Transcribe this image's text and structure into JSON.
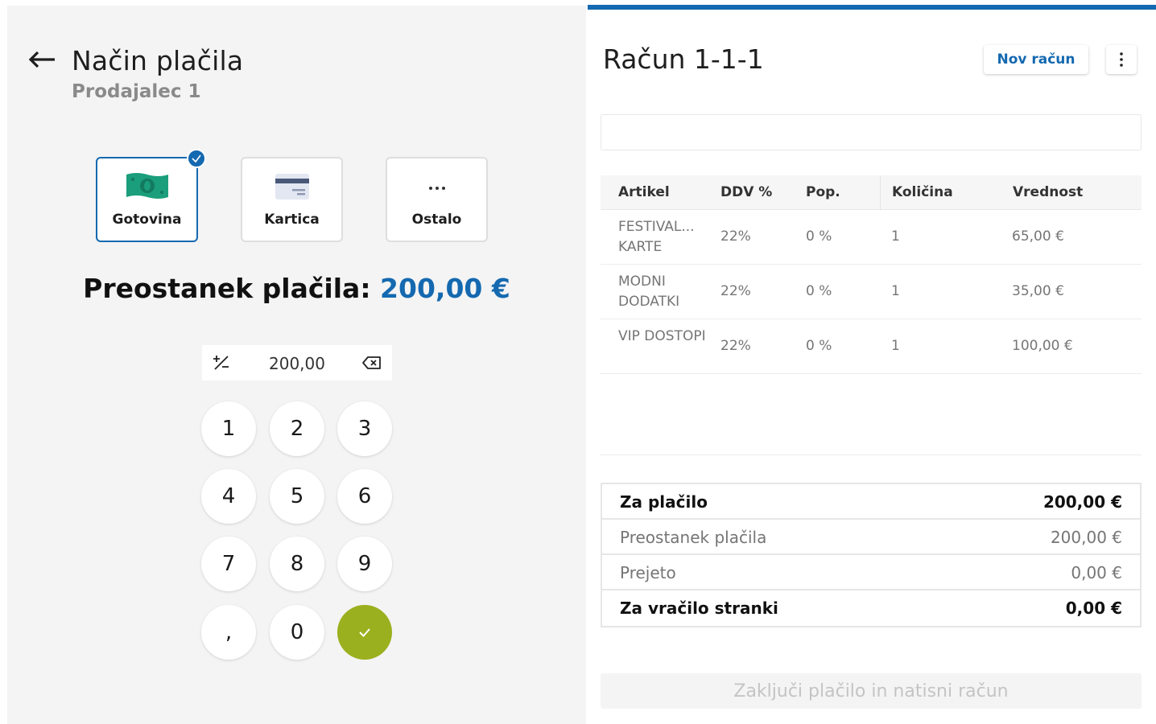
{
  "payment": {
    "title": "Način plačila",
    "subtitle": "Prodajalec 1",
    "methods": [
      {
        "label": "Gotovina",
        "icon": "cash-icon",
        "selected": true
      },
      {
        "label": "Kartica",
        "icon": "card-icon",
        "selected": false
      },
      {
        "label": "Ostalo",
        "icon": "more-horizontal-icon",
        "selected": false
      }
    ],
    "remaining_label": "Preostanek plačila:",
    "remaining_amount": "200,00 €",
    "amount_value": "200,00",
    "keypad": [
      "1",
      "2",
      "3",
      "4",
      "5",
      "6",
      "7",
      "8",
      "9",
      ",",
      "0"
    ]
  },
  "receipt": {
    "title": "Račun 1-1-1",
    "new_button": "Nov račun",
    "columns": [
      "Artikel",
      "DDV %",
      "Pop.",
      "Količina",
      "Vrednost"
    ],
    "items": [
      {
        "name": "FESTIVAL... KARTE",
        "vat": "22%",
        "discount": "0 %",
        "qty": "1",
        "value": "65,00 €"
      },
      {
        "name": "MODNI DODATKI",
        "vat": "22%",
        "discount": "0 %",
        "qty": "1",
        "value": "35,00 €"
      },
      {
        "name": "VIP DOSTOPI",
        "vat": "22%",
        "discount": "0 %",
        "qty": "1",
        "value": "100,00 €"
      }
    ],
    "summary": {
      "to_pay_label": "Za plačilo",
      "to_pay": "200,00 €",
      "remaining_label": "Preostanek plačila",
      "remaining": "200,00 €",
      "received_label": "Prejeto",
      "received": "0,00 €",
      "change_label": "Za vračilo stranki",
      "change": "0,00 €"
    },
    "finish_button": "Zaključi plačilo in natisni račun"
  },
  "colors": {
    "accent": "#1469b0",
    "confirm": "#9bb01e",
    "cash": "#1a9e7c"
  }
}
